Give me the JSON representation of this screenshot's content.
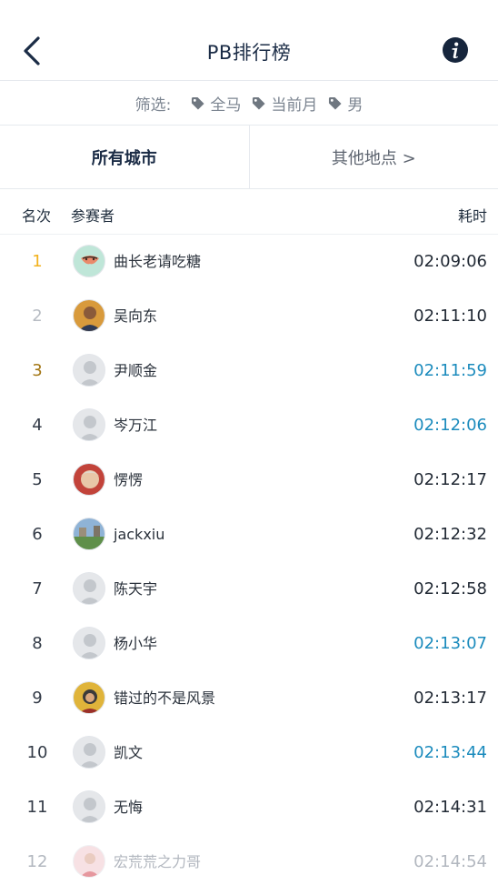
{
  "header": {
    "title": "PB排行榜",
    "back_icon": "chevron-left-icon",
    "info_icon": "info-icon"
  },
  "filters": {
    "label": "筛选:",
    "chips": [
      "全马",
      "当前月",
      "男"
    ],
    "chip_icon": "tag-icon"
  },
  "tabs": {
    "active": "所有城市",
    "other": "其他地点 >"
  },
  "columns": {
    "rank": "名次",
    "runner": "参赛者",
    "time": "耗时"
  },
  "colors": {
    "accent_blue": "#1b8bbd",
    "gold": "#f2b21e",
    "silver": "#b7bcc3",
    "bronze": "#a37614",
    "title": "#1b2c46"
  },
  "rows": [
    {
      "rank": "1",
      "name": "曲长老请吃糖",
      "time": "02:09:06",
      "avatar": "butterfly-avatar"
    },
    {
      "rank": "2",
      "name": "吴向东",
      "time": "02:11:10",
      "avatar": "photo-avatar"
    },
    {
      "rank": "3",
      "name": "尹顺金",
      "time": "02:11:59",
      "avatar": "default-avatar"
    },
    {
      "rank": "4",
      "name": "岑万江",
      "time": "02:12:06",
      "avatar": "default-avatar"
    },
    {
      "rank": "5",
      "name": "愣愣",
      "time": "02:12:17",
      "avatar": "photo-avatar"
    },
    {
      "rank": "6",
      "name": "jackxiu",
      "time": "02:12:32",
      "avatar": "landscape-avatar"
    },
    {
      "rank": "7",
      "name": "陈天宇",
      "time": "02:12:58",
      "avatar": "default-avatar"
    },
    {
      "rank": "8",
      "name": "杨小华",
      "time": "02:13:07",
      "avatar": "default-avatar"
    },
    {
      "rank": "9",
      "name": "错过的不是风景",
      "time": "02:13:17",
      "avatar": "photo-avatar"
    },
    {
      "rank": "10",
      "name": "凯文",
      "time": "02:13:44",
      "avatar": "default-avatar"
    },
    {
      "rank": "11",
      "name": "无悔",
      "time": "02:14:31",
      "avatar": "default-avatar"
    },
    {
      "rank": "12",
      "name": "宏荒荒之力哥",
      "time": "02:14:54",
      "avatar": "photo-avatar"
    }
  ]
}
